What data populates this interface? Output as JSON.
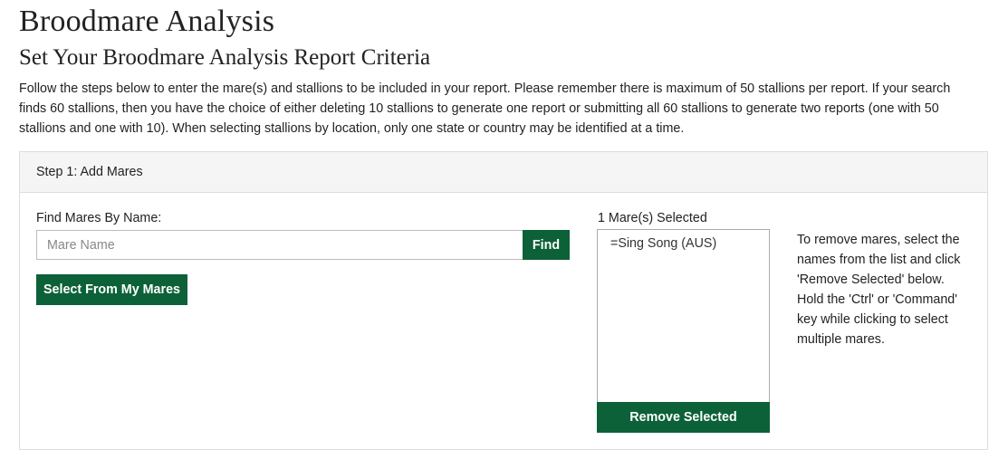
{
  "header": {
    "title": "Broodmare Analysis",
    "subtitle": "Set Your Broodmare Analysis Report Criteria",
    "intro": "Follow the steps below to enter the mare(s) and stallions to be included in your report. Please remember there is maximum of 50 stallions per report. If your search finds 60 stallions, then you have the choice of either deleting 10 stallions to generate one report or submitting all 60 stallions to generate two reports (one with 50 stallions and one with 10). When selecting stallions by location, only one state or country may be identified at a time."
  },
  "step1": {
    "heading": "Step 1: Add Mares",
    "find_label": "Find Mares By Name:",
    "search": {
      "placeholder": "Mare Name",
      "value": ""
    },
    "find_button": "Find",
    "select_my_mares_button": "Select From My Mares",
    "selected_label": "1 Mare(s) Selected",
    "selected_mares": [
      "=Sing Song (AUS)"
    ],
    "remove_button": "Remove Selected",
    "remove_help": "To remove mares, select the names from the list and click 'Remove Selected' below. Hold the 'Ctrl' or 'Command' key while clicking to select multiple mares."
  },
  "colors": {
    "accent": "#0d6138",
    "panel_heading_bg": "#f5f5f5",
    "border": "#dddddd"
  }
}
